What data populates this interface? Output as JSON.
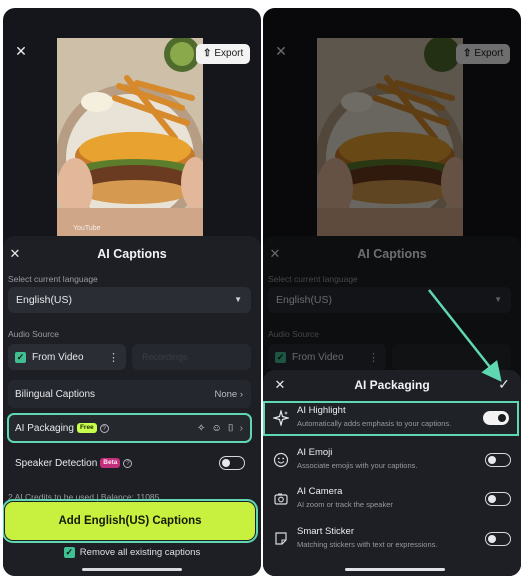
{
  "left": {
    "export_label": "Export",
    "close_symbol": "✕",
    "watermark": "YouTube",
    "panel": {
      "title": "AI Captions",
      "language_label": "Select current language",
      "language_value": "English(US)",
      "audio_source_label": "Audio Source",
      "audio_source_value": "From Video",
      "audio_source_secondary": "Recordings",
      "rows": [
        {
          "label": "Bilingual Captions",
          "value": "None"
        },
        {
          "label": "AI Packaging",
          "badge": "Free"
        },
        {
          "label": "Speaker Detection",
          "badge": "Beta"
        }
      ],
      "credits_text": "2 AI Credits to be used  |  Balance: 11085",
      "primary_button": "Add English(US) Captions",
      "remove_label": "Remove all existing captions"
    }
  },
  "right": {
    "export_label": "Export",
    "panel": {
      "title": "AI Captions",
      "language_label": "Select current language",
      "language_value": "English(US)",
      "audio_source_label": "Audio Source",
      "audio_source_value": "From Video"
    },
    "sheet": {
      "title": "AI Packaging",
      "features": [
        {
          "title": "AI Highlight",
          "desc": "Automatically adds emphasis to your captions.",
          "icon": "sparkle-icon",
          "enabled": true
        },
        {
          "title": "AI Emoji",
          "desc": "Associate emojis with your captions.",
          "icon": "emoji-icon",
          "enabled": false
        },
        {
          "title": "AI Camera",
          "desc": "AI zoom or track the speaker",
          "icon": "camera-icon",
          "enabled": false
        },
        {
          "title": "Smart Sticker",
          "desc": "Matching stickers with text or expressions.",
          "icon": "sticker-icon",
          "enabled": false
        }
      ]
    }
  },
  "colors": {
    "accent_highlight": "#5fd7b0",
    "primary_button": "#c8f03e",
    "free_badge": "#c8ff4d",
    "beta_badge": "#c12f7a"
  }
}
